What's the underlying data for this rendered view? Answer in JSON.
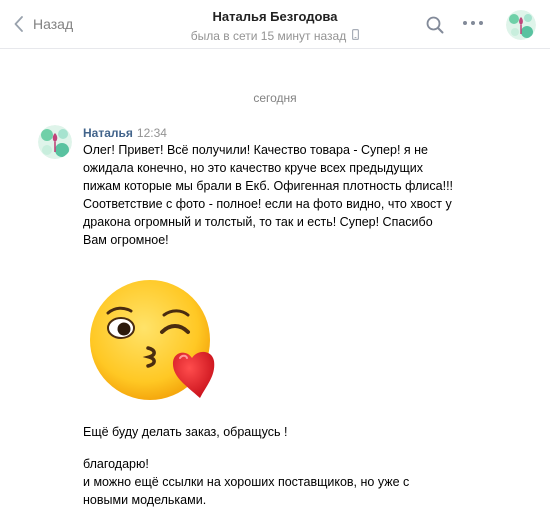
{
  "header": {
    "back_label": "Назад",
    "peer_name": "Наталья Безгодова",
    "peer_status": "была в сети 15 минут назад"
  },
  "icons": {
    "back": "chevron-left-icon",
    "search": "search-icon",
    "more": "more-horizontal-icon",
    "mobile": "mobile-phone-icon",
    "sticker": "kissing-face-heart-sticker"
  },
  "colors": {
    "author_link": "#42648b",
    "muted": "#939393",
    "divider": "#e7e8ec"
  },
  "chat": {
    "date_separator": "сегодня",
    "messages": [
      {
        "author": "Наталья",
        "time": "12:34",
        "text": "Олег! Привет! Всё получили! Качество товара - Супер! я не\nожидала конечно, но это качество круче всех предыдущих\nпижам которые мы брали в Екб. Офигенная плотность флиса!!!\nСоответствие с фото - полное! если на фото видно, что хвост у\nдракона огромный и толстый, то так и есть! Супер! Спасибо\nВам огромное!"
      },
      {
        "text": "Ещё буду делать заказ, обращусь !"
      },
      {
        "text": "благодарю!\nи можно ещё ссылки на хороших поставщиков, но уже с\nновыми модельками."
      }
    ]
  }
}
